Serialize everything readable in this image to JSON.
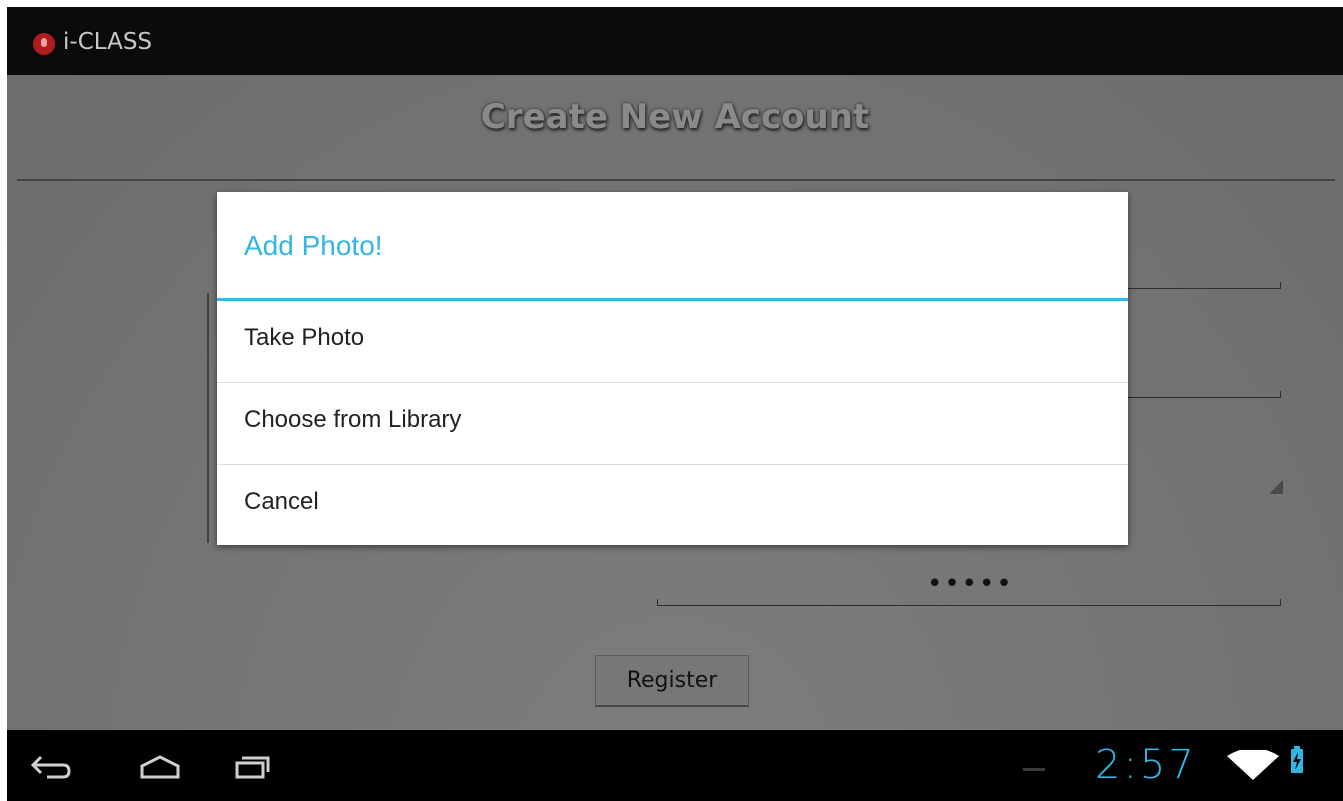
{
  "action_bar": {
    "app_title": "i-CLASS",
    "icon": "app-mic-icon"
  },
  "form": {
    "page_title": "Create New Account",
    "password_value": "•••••",
    "register_label": "Register"
  },
  "dialog": {
    "title": "Add Photo!",
    "items": [
      "Take Photo",
      "Choose from Library",
      "Cancel"
    ],
    "accent_color": "#33b5e5"
  },
  "system_bar": {
    "clock": "2:57",
    "icons": [
      "back-icon",
      "home-icon",
      "recent-apps-icon",
      "wifi-icon",
      "battery-charging-icon"
    ]
  }
}
